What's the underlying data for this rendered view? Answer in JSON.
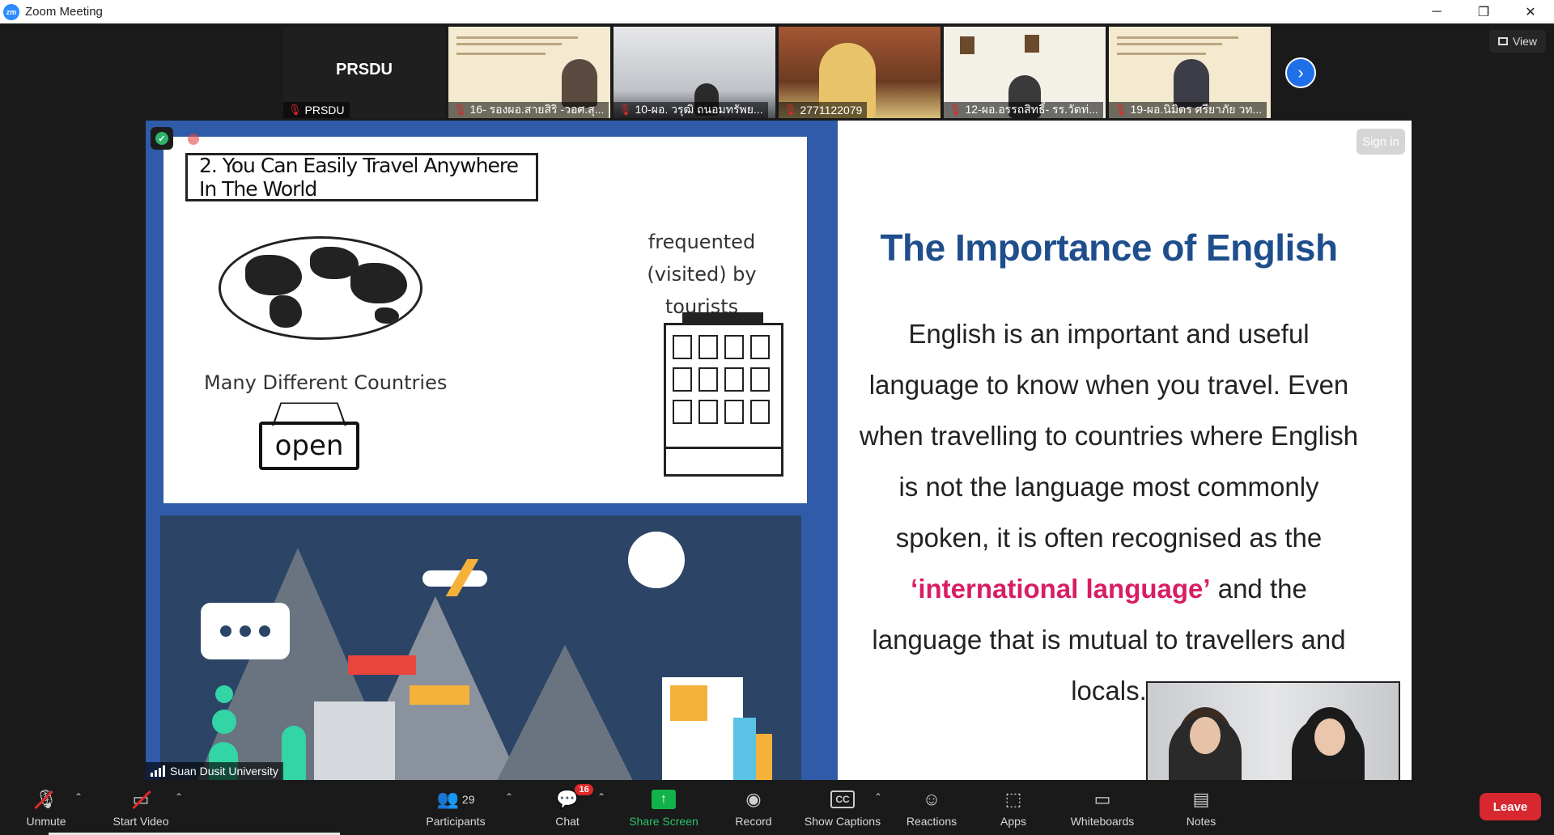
{
  "window": {
    "title": "Zoom Meeting",
    "logo_text": "zm",
    "controls": {
      "minimize": "─",
      "restore": "❐",
      "close": "✕"
    }
  },
  "participants_strip": [
    {
      "name": "PRSDU",
      "big_label": "PRSDU",
      "muted": true
    },
    {
      "name": "16- รองผอ.สายสิริ -วอศ.สุ...",
      "muted": true
    },
    {
      "name": "10-ผอ. วรุฒิ ถนอมทรัพย...",
      "muted": true
    },
    {
      "name": "2771122079",
      "muted": true
    },
    {
      "name": "12-ผอ.อรรถสิทธิ์- รร.วัดท่...",
      "muted": true
    },
    {
      "name": "19-ผอ.นิมิตร ศรียาภัย  วท...",
      "muted": true
    }
  ],
  "strip_next_icon": "›",
  "view_button": {
    "label": "View"
  },
  "shared_screen": {
    "signin_label": "Sign in",
    "left_slide": {
      "heading": "2. You Can Easily Travel Anywhere In The World",
      "caption_countries": "Many Different Countries",
      "sign_text": "open",
      "caption_tourists": "frequented (visited) by tourists"
    },
    "right_slide": {
      "title": "The Importance of English",
      "body_before": "English is an important and useful language to know when you travel. Even when travelling to countries where English is not the language most commonly spoken, it is often recognised as the ",
      "body_highlight": "‘international language’",
      "body_after": " and the language that is mutual to travellers and locals."
    }
  },
  "active_speaker": {
    "label": "Suan Dusit University"
  },
  "toolbar": {
    "unmute": "Unmute",
    "start_video": "Start Video",
    "participants": "Participants",
    "participants_count": "29",
    "chat": "Chat",
    "chat_badge": "16",
    "share_screen": "Share Screen",
    "record": "Record",
    "show_captions": "Show Captions",
    "captions_icon_text": "CC",
    "reactions": "Reactions",
    "apps": "Apps",
    "whiteboards": "Whiteboards",
    "notes": "Notes",
    "leave": "Leave"
  },
  "colors": {
    "accent_blue": "#2d8cff",
    "share_green": "#12b24a",
    "leave_red": "#d7282f",
    "title_blue": "#1f4e8c",
    "highlight_pink": "#d81d63",
    "slide_blue": "#2f5ba8"
  }
}
